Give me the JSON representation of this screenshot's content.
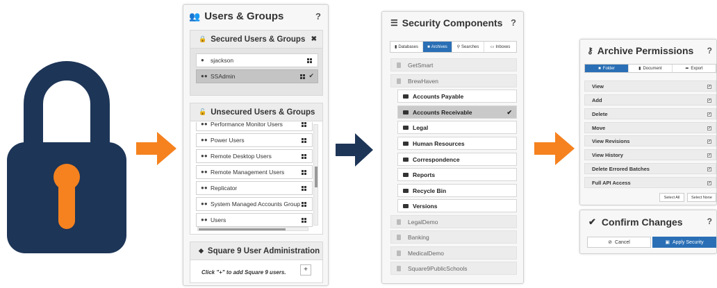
{
  "users_groups": {
    "title": "Users & Groups",
    "help": "?",
    "secured": {
      "title": "Secured Users & Groups",
      "close": "✖",
      "items": [
        {
          "label": "sjackson",
          "selected": false
        },
        {
          "label": "SSAdmin",
          "selected": true
        }
      ]
    },
    "unsecured": {
      "title": "Unsecured Users & Groups",
      "items": [
        {
          "label": "Performance Monitor Users"
        },
        {
          "label": "Power Users"
        },
        {
          "label": "Remote Desktop Users"
        },
        {
          "label": "Remote Management Users"
        },
        {
          "label": "Replicator"
        },
        {
          "label": "System Managed Accounts Group"
        },
        {
          "label": "Users"
        }
      ]
    },
    "admin": {
      "title": "Square 9 User Administration",
      "hint": "Click \"+\" to add Square 9 users.",
      "add": "+"
    }
  },
  "security_components": {
    "title": "Security Components",
    "help": "?",
    "tabs": [
      {
        "label": "Databases",
        "active": false
      },
      {
        "label": "Archives",
        "active": true
      },
      {
        "label": "Searches",
        "active": false
      },
      {
        "label": "Inboxes",
        "active": false
      }
    ],
    "tree": [
      {
        "label": "GetSmart",
        "kind": "db"
      },
      {
        "label": "BrewHaven",
        "kind": "db"
      },
      {
        "label": "Accounts Payable",
        "kind": "archive"
      },
      {
        "label": "Accounts Receivable",
        "kind": "archive",
        "selected": true
      },
      {
        "label": "Legal",
        "kind": "archive"
      },
      {
        "label": "Human Resources",
        "kind": "archive"
      },
      {
        "label": "Correspondence",
        "kind": "archive"
      },
      {
        "label": "Reports",
        "kind": "archive"
      },
      {
        "label": "Recycle Bin",
        "kind": "archive"
      },
      {
        "label": "Versions",
        "kind": "archive"
      },
      {
        "label": "LegalDemo",
        "kind": "db"
      },
      {
        "label": "Banking",
        "kind": "db"
      },
      {
        "label": "MedicalDemo",
        "kind": "db"
      },
      {
        "label": "Square9PublicSchools",
        "kind": "db"
      }
    ]
  },
  "archive_permissions": {
    "title": "Archive Permissions",
    "help": "?",
    "tabs": [
      {
        "label": "Folder",
        "active": true
      },
      {
        "label": "Document",
        "active": false
      },
      {
        "label": "Export",
        "active": false
      }
    ],
    "permissions": [
      {
        "label": "View",
        "checked": true
      },
      {
        "label": "Add",
        "checked": true
      },
      {
        "label": "Delete",
        "checked": true
      },
      {
        "label": "Move",
        "checked": true
      },
      {
        "label": "View Revisions",
        "checked": true
      },
      {
        "label": "View History",
        "checked": true
      },
      {
        "label": "Delete Errored Batches",
        "checked": true
      },
      {
        "label": "Full API Access",
        "checked": true
      }
    ],
    "select_all": "Select All",
    "select_none": "Select None"
  },
  "confirm": {
    "title": "Confirm Changes",
    "help": "?",
    "cancel": "Cancel",
    "apply": "Apply Security"
  },
  "colors": {
    "navy": "#1d3557",
    "orange": "#f5821f",
    "accent_blue": "#2a6fb5"
  }
}
